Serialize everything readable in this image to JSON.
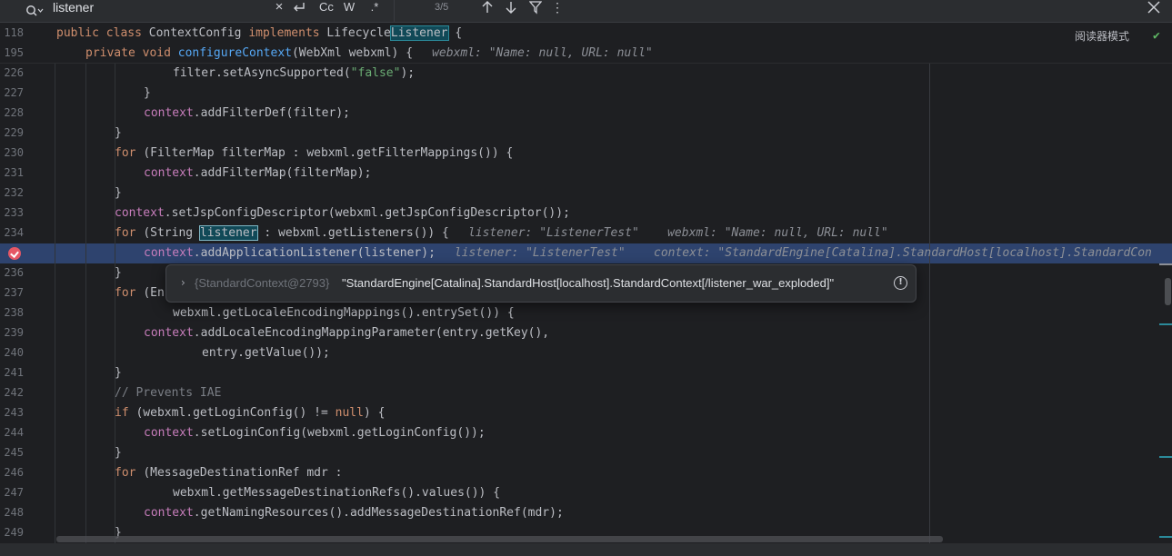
{
  "find_bar": {
    "query": "listener",
    "match_case_label": "Cc",
    "words_label": "W",
    "regex_label": ".*",
    "count": "3/5"
  },
  "editor": {
    "reader_mode_label": "阅读器模式",
    "sticky_lines": [
      {
        "line": "118",
        "tokens": [
          {
            "t": "public class ",
            "c": "kw"
          },
          {
            "t": "ContextConfig ",
            "c": "pl"
          },
          {
            "t": "implements ",
            "c": "kw"
          },
          {
            "t": "Lifecycle",
            "c": "pl"
          },
          {
            "t": "Listener",
            "c": "pl",
            "m": "match"
          },
          {
            "t": " {",
            "c": "pl"
          }
        ],
        "indent": 62
      },
      {
        "line": "195",
        "tokens": [
          {
            "t": "private void ",
            "c": "kw"
          },
          {
            "t": "configureContext",
            "c": "fn"
          },
          {
            "t": "(WebXml webxml) {",
            "c": "pl"
          }
        ],
        "indent": 94,
        "hint": "webxml: \"Name: null, URL: null\""
      }
    ],
    "lines": [
      {
        "line": "226",
        "indent": 190,
        "tokens": [
          {
            "t": "filter.setAsyncSupported(",
            "c": "pl"
          },
          {
            "t": "\"false\"",
            "c": "str"
          },
          {
            "t": ");",
            "c": "pl"
          }
        ]
      },
      {
        "line": "227",
        "indent": 158,
        "tokens": [
          {
            "t": "}",
            "c": "pl"
          }
        ]
      },
      {
        "line": "228",
        "indent": 158,
        "tokens": [
          {
            "t": "context",
            "c": "fld"
          },
          {
            "t": ".addFilterDef(filter);",
            "c": "pl"
          }
        ]
      },
      {
        "line": "229",
        "indent": 126,
        "tokens": [
          {
            "t": "}",
            "c": "pl"
          }
        ]
      },
      {
        "line": "230",
        "indent": 126,
        "tokens": [
          {
            "t": "for ",
            "c": "kw"
          },
          {
            "t": "(FilterMap filterMap : webxml.getFilterMappings()) {",
            "c": "pl"
          }
        ]
      },
      {
        "line": "231",
        "indent": 158,
        "tokens": [
          {
            "t": "context",
            "c": "fld"
          },
          {
            "t": ".addFilterMap(filterMap);",
            "c": "pl"
          }
        ]
      },
      {
        "line": "232",
        "indent": 126,
        "tokens": [
          {
            "t": "}",
            "c": "pl"
          }
        ]
      },
      {
        "line": "233",
        "indent": 126,
        "tokens": [
          {
            "t": "context",
            "c": "fld"
          },
          {
            "t": ".setJspConfigDescriptor(webxml.getJspConfigDescriptor());",
            "c": "pl"
          }
        ]
      },
      {
        "line": "234",
        "indent": 126,
        "tokens": [
          {
            "t": "for ",
            "c": "kw"
          },
          {
            "t": "(String ",
            "c": "pl"
          },
          {
            "t": "listener",
            "c": "pl",
            "m": "match-cur"
          },
          {
            "t": " : webxml.getListeners()) {",
            "c": "pl"
          }
        ],
        "hint": "listener: \"ListenerTest\"    webxml: \"Name: null, URL: null\""
      },
      {
        "line": "",
        "indent": 158,
        "exec": true,
        "tokens": [
          {
            "t": "context",
            "c": "fld"
          },
          {
            "t": ".addApplicationListener(listener);",
            "c": "pl"
          }
        ],
        "hint": "listener: \"ListenerTest\"    context: \"StandardEngine[Catalina].StandardHost[localhost].StandardCon"
      },
      {
        "line": "236",
        "indent": 126,
        "tokens": [
          {
            "t": "}",
            "c": "pl"
          }
        ]
      },
      {
        "line": "237",
        "indent": 126,
        "tokens": [
          {
            "t": "for ",
            "c": "kw"
          },
          {
            "t": "(En",
            "c": "pl"
          }
        ]
      },
      {
        "line": "238",
        "indent": 190,
        "tokens": [
          {
            "t": "webxml.getLocaleEncodingMappings().entrySet()) {",
            "c": "pl"
          }
        ]
      },
      {
        "line": "239",
        "indent": 158,
        "tokens": [
          {
            "t": "context",
            "c": "fld"
          },
          {
            "t": ".addLocaleEncodingMappingParameter(entry.getKey(),",
            "c": "pl"
          }
        ]
      },
      {
        "line": "240",
        "indent": 222,
        "tokens": [
          {
            "t": "entry.getValue());",
            "c": "pl"
          }
        ]
      },
      {
        "line": "241",
        "indent": 126,
        "tokens": [
          {
            "t": "}",
            "c": "pl"
          }
        ]
      },
      {
        "line": "242",
        "indent": 126,
        "tokens": [
          {
            "t": "// Prevents IAE",
            "c": "cmt"
          }
        ]
      },
      {
        "line": "243",
        "indent": 126,
        "tokens": [
          {
            "t": "if ",
            "c": "kw"
          },
          {
            "t": "(webxml.getLoginConfig() != ",
            "c": "pl"
          },
          {
            "t": "null",
            "c": "kw"
          },
          {
            "t": ") {",
            "c": "pl"
          }
        ]
      },
      {
        "line": "244",
        "indent": 158,
        "tokens": [
          {
            "t": "context",
            "c": "fld"
          },
          {
            "t": ".setLoginConfig(webxml.getLoginConfig());",
            "c": "pl"
          }
        ]
      },
      {
        "line": "245",
        "indent": 126,
        "tokens": [
          {
            "t": "}",
            "c": "pl"
          }
        ]
      },
      {
        "line": "246",
        "indent": 126,
        "tokens": [
          {
            "t": "for ",
            "c": "kw"
          },
          {
            "t": "(MessageDestinationRef mdr :",
            "c": "pl"
          }
        ]
      },
      {
        "line": "247",
        "indent": 190,
        "tokens": [
          {
            "t": "webxml.getMessageDestinationRefs().values()) {",
            "c": "pl"
          }
        ]
      },
      {
        "line": "248",
        "indent": 158,
        "tokens": [
          {
            "t": "context",
            "c": "fld"
          },
          {
            "t": ".getNamingResources().addMessageDestinationRef(mdr);",
            "c": "pl"
          }
        ]
      },
      {
        "line": "249",
        "indent": 126,
        "tokens": [
          {
            "t": "}",
            "c": "pl"
          }
        ]
      }
    ]
  },
  "popup": {
    "ref": "{StandardContext@2793}",
    "value": "\"StandardEngine[Catalina].StandardHost[localhost].StandardContext[/listener_war_exploded]\"",
    "info_glyph": "!"
  }
}
